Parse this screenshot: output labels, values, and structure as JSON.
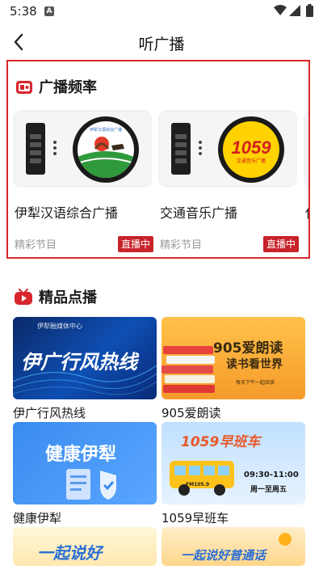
{
  "status_bar": {
    "time": "5:38",
    "notification_badge": "A"
  },
  "header": {
    "title": "听广播",
    "back_icon": "chevron-left-icon"
  },
  "radio_section": {
    "title": "广播频率",
    "accent_color": "#d9262c",
    "stations": [
      {
        "name": "伊犁汉语综合广播",
        "subtitle": "精彩节目",
        "live_label": "直播中",
        "logo": "ili-chinese-radio-logo"
      },
      {
        "name": "交通音乐广播",
        "subtitle": "精彩节目",
        "live_label": "直播中",
        "logo_text": "1059",
        "logo_sub": "交通音乐广播"
      },
      {
        "name": "伊"
      }
    ]
  },
  "vod_section": {
    "title": "精品点播",
    "items": [
      {
        "caption": "伊广行风热线",
        "image_title": "伊广行风热线",
        "image_sub": "伊犁融媒体中心"
      },
      {
        "caption": "905爱朗读",
        "image_title": "905爱朗读",
        "image_sub": "读书看世界",
        "image_foot": "每天下午一起阅读"
      },
      {
        "caption": "健康伊犁",
        "image_title": "健康伊犁"
      },
      {
        "caption": "1059早班车",
        "image_title": "1059早班车",
        "image_time": "09:30-11:00",
        "image_days": "周一至周五",
        "bus_plate": "FM105.9"
      },
      {
        "caption": "",
        "image_title": "一起说好"
      },
      {
        "caption": "",
        "image_title": "一起说好普通话"
      }
    ]
  }
}
